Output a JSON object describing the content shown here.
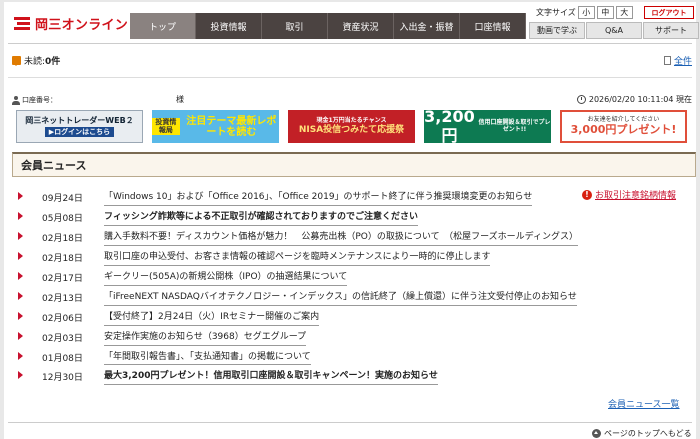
{
  "header": {
    "logo_text": "岡三オンライン",
    "nav": [
      "トップ",
      "投資情報",
      "取引",
      "資産状況",
      "入出金・振替",
      "口座情報"
    ],
    "font_size_label": "文字サイズ",
    "font_sizes": [
      "小",
      "中",
      "大"
    ],
    "logout_label": "ログアウト",
    "subnav": [
      "動画で学ぶ",
      "Q&A",
      "サポート"
    ]
  },
  "unread": {
    "label": "未読:",
    "count": "0件"
  },
  "all_link": "全件",
  "account": {
    "label": "口座番号：",
    "honorific": "様",
    "datetime": "2026/02/20 10:11:04 現在"
  },
  "banners": {
    "b1": {
      "title": "岡三ネットトレーダーWEB２",
      "sub": "▶ログインはこちら"
    },
    "b2": {
      "tag": "投資情報局",
      "text": "注目テーマ最新レポートを読む"
    },
    "b3": {
      "small": "現金1万円当たるチャンス",
      "big": "NISA投信つみたて応援祭"
    },
    "b4": {
      "big": "3,200円",
      "small": "信用口座開設＆取引でプレゼント!!"
    },
    "b5": {
      "small": "お友達を紹介してください",
      "big": "3,000円プレゼント!"
    }
  },
  "news_header": "会員ニュース",
  "caution": "お取引注意銘柄情報",
  "news": [
    {
      "date": "09月24日",
      "title": "「Windows 10」および「Office 2016」、「Office 2019」のサポート終了に伴う推奨環境変更のお知らせ",
      "bold": false
    },
    {
      "date": "05月08日",
      "title": "フィッシング詐欺等による不正取引が確認されておりますのでご注意ください",
      "bold": true
    },
    {
      "date": "02月18日",
      "title": "購入手数料不要！ディスカウント価格が魅力！　公募売出株（PO）の取扱について　（松屋フーズホールディングス）",
      "bold": false
    },
    {
      "date": "02月18日",
      "title": "取引口座の申込受付、お客さま情報の確認ページを臨時メンテナンスにより一時的に停止します",
      "bold": false
    },
    {
      "date": "02月17日",
      "title": "ギークリー(505A)の新規公開株（IPO）の抽選結果について",
      "bold": false
    },
    {
      "date": "02月13日",
      "title": "「iFreeNEXT NASDAQバイオテクノロジー・インデックス」の信託終了（繰上償還）に伴う注文受付停止のお知らせ",
      "bold": false
    },
    {
      "date": "02月06日",
      "title": "【受付終了】2月24日（火）IRセミナー開催のご案内",
      "bold": false
    },
    {
      "date": "02月03日",
      "title": "安定操作実施のお知らせ（3968）セグエグループ",
      "bold": false
    },
    {
      "date": "01月08日",
      "title": "「年間取引報告書」、「支払通知書」の掲載について",
      "bold": false
    },
    {
      "date": "12月30日",
      "title": "最大3,200円プレゼント！信用取引口座開設＆取引キャンペーン！実施のお知らせ",
      "bold": true
    }
  ],
  "news_more": "会員ニュース一覧",
  "top_link": "ページのトップへもどる"
}
